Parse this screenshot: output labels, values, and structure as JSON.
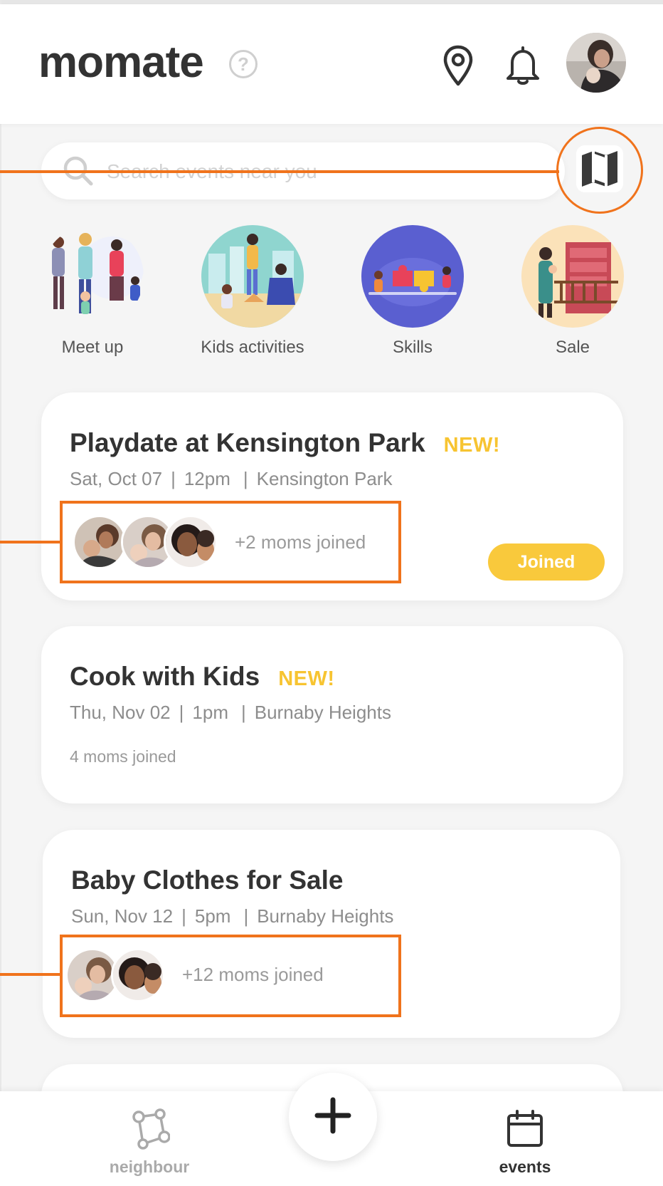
{
  "app": {
    "name": "momate",
    "help_glyph": "?"
  },
  "header": {
    "icons": [
      "location-pin-icon",
      "bell-icon",
      "avatar"
    ]
  },
  "search": {
    "placeholder": "Search events near you",
    "value": ""
  },
  "categories": [
    {
      "label": "Meet up",
      "icon": "meet-up-illustration"
    },
    {
      "label": "Kids activities",
      "icon": "kids-activities-illustration"
    },
    {
      "label": "Skills",
      "icon": "skills-puzzle-illustration"
    },
    {
      "label": "Sale",
      "icon": "sale-shelf-illustration"
    }
  ],
  "events": [
    {
      "title": "Playdate at Kensington Park",
      "badge": "NEW!",
      "date": "Sat, Oct 07",
      "time": "12pm",
      "location": "Kensington Park",
      "joined": "+2 moms joined",
      "button": "Joined"
    },
    {
      "title": "Cook with Kids",
      "badge": "NEW!",
      "date": "Thu, Nov 02",
      "time": "1pm",
      "location": "Burnaby Heights",
      "joined": "4 moms joined"
    },
    {
      "title": "Baby Clothes for Sale",
      "date": "Sun, Nov 12",
      "time": "5pm",
      "location": "Burnaby Heights",
      "joined": "+12 moms joined"
    }
  ],
  "separator": "|",
  "bottom_nav": {
    "neighbour": "neighbour",
    "events": "events",
    "add_glyph": "+"
  },
  "colors": {
    "accent": "#f9c93c",
    "annotation": "#f0731c",
    "text": "#333333",
    "muted": "#8d8d8d",
    "skills_bg": "#5a5fd0"
  }
}
